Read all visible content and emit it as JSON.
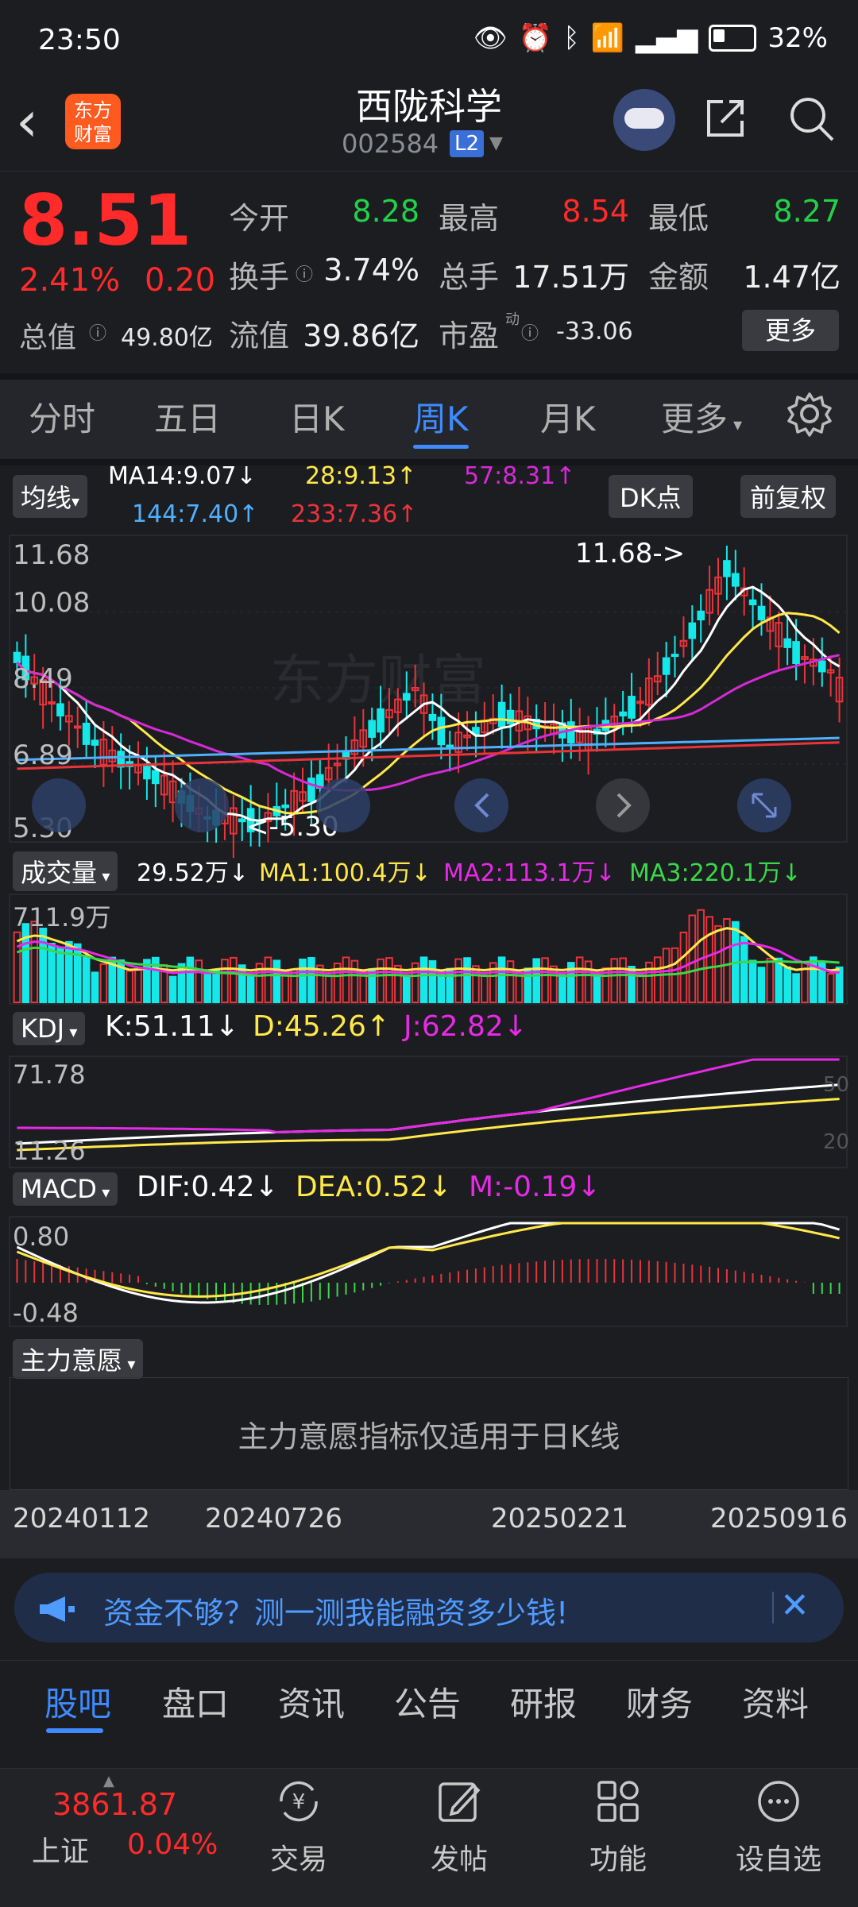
{
  "status": {
    "time": "23:50",
    "battery": "32%"
  },
  "header": {
    "logo_text": "东方财富",
    "name": "西陇科学",
    "code": "002584",
    "level_badge": "L2"
  },
  "quote": {
    "price": "8.51",
    "change_pct": "2.41%",
    "change_amt": "0.20",
    "open_label": "今开",
    "open": "8.28",
    "high_label": "最高",
    "high": "8.54",
    "low_label": "最低",
    "low": "8.27",
    "turnover_label": "换手",
    "turnover": "3.74%",
    "volume_label": "总手",
    "volume": "17.51万",
    "amount_label": "金额",
    "amount": "1.47亿",
    "mktcap_label": "总值",
    "mktcap": "49.80亿",
    "float_label": "流值",
    "float": "39.86亿",
    "pe_label": "市盈",
    "pe_sup": "动",
    "pe": "-33.06",
    "more": "更多"
  },
  "tabs": [
    "分时",
    "五日",
    "日K",
    "周K",
    "月K",
    "更多"
  ],
  "kline": {
    "ma_button": "均线",
    "ma14": "MA14:9.07",
    "ma28": "28:9.13",
    "ma57": "57:8.31",
    "ma144": "144:7.40",
    "ma233": "233:7.36",
    "dk_button": "DK点",
    "adjust_button": "前复权",
    "y_labels": [
      "11.68",
      "10.08",
      "8.49",
      "6.89",
      "5.30"
    ],
    "max_mark": "11.68->",
    "min_mark": "<-5.30",
    "watermark": "东方财富",
    "colors": {
      "ma14": "#ffffff",
      "ma28": "#ffe84a",
      "ma57": "#d62ad6",
      "ma144": "#4fb0ff",
      "ma233": "#e8343a",
      "up": "#e8343a",
      "down": "#15e8e8"
    }
  },
  "volume": {
    "button": "成交量",
    "vol": "29.52万",
    "ma1": "MA1:100.4万",
    "ma2": "MA2:113.1万",
    "ma3": "MA3:220.1万",
    "max_label": "711.9万"
  },
  "kdj": {
    "button": "KDJ",
    "k": "K:51.11",
    "d": "D:45.26",
    "j": "J:62.82",
    "top": "71.78",
    "bottom": "11.26",
    "level_hi": "50",
    "level_lo": "20"
  },
  "macd": {
    "button": "MACD",
    "dif": "DIF:0.42",
    "dea": "DEA:0.52",
    "m": "M:-0.19",
    "top": "0.80",
    "bottom": "-0.48"
  },
  "zhuli": {
    "button": "主力意愿",
    "message": "主力意愿指标仅适用于日K线"
  },
  "dates": [
    "20240112",
    "20240726",
    "20250221",
    "20250916"
  ],
  "banner": {
    "text": "资金不够？测一测我能融资多少钱!",
    "close": "✕"
  },
  "bottom_tabs": [
    "股吧",
    "盘口",
    "资讯",
    "公告",
    "研报",
    "财务",
    "资料"
  ],
  "nav": {
    "index_value": "3861.87",
    "index_name": "上证",
    "index_pct": "0.04%",
    "items": [
      "交易",
      "发帖",
      "功能",
      "设自选"
    ]
  },
  "arrows": {
    "down": "↓",
    "up": "↑"
  }
}
